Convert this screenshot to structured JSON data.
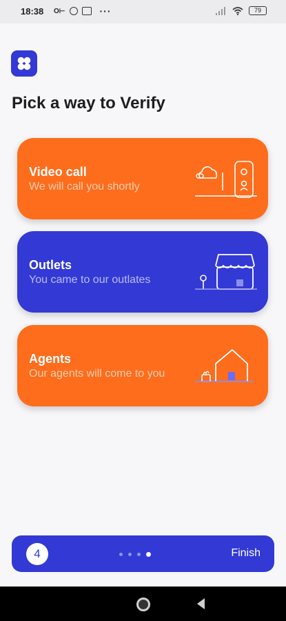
{
  "status_bar": {
    "time": "18:38",
    "battery": "79"
  },
  "page": {
    "title": "Pick a way to Verify"
  },
  "options": [
    {
      "title": "Video call",
      "subtitle": "We will call you shortly"
    },
    {
      "title": "Outlets",
      "subtitle": "You came to our outlates"
    },
    {
      "title": "Agents",
      "subtitle": "Our agents will come to you"
    }
  ],
  "footer": {
    "step": "4",
    "finish_label": "Finish",
    "total_steps": 4,
    "current_step_index": 3
  },
  "colors": {
    "orange": "#fd6d1c",
    "blue": "#3339d4",
    "background": "#f7f7f9"
  }
}
